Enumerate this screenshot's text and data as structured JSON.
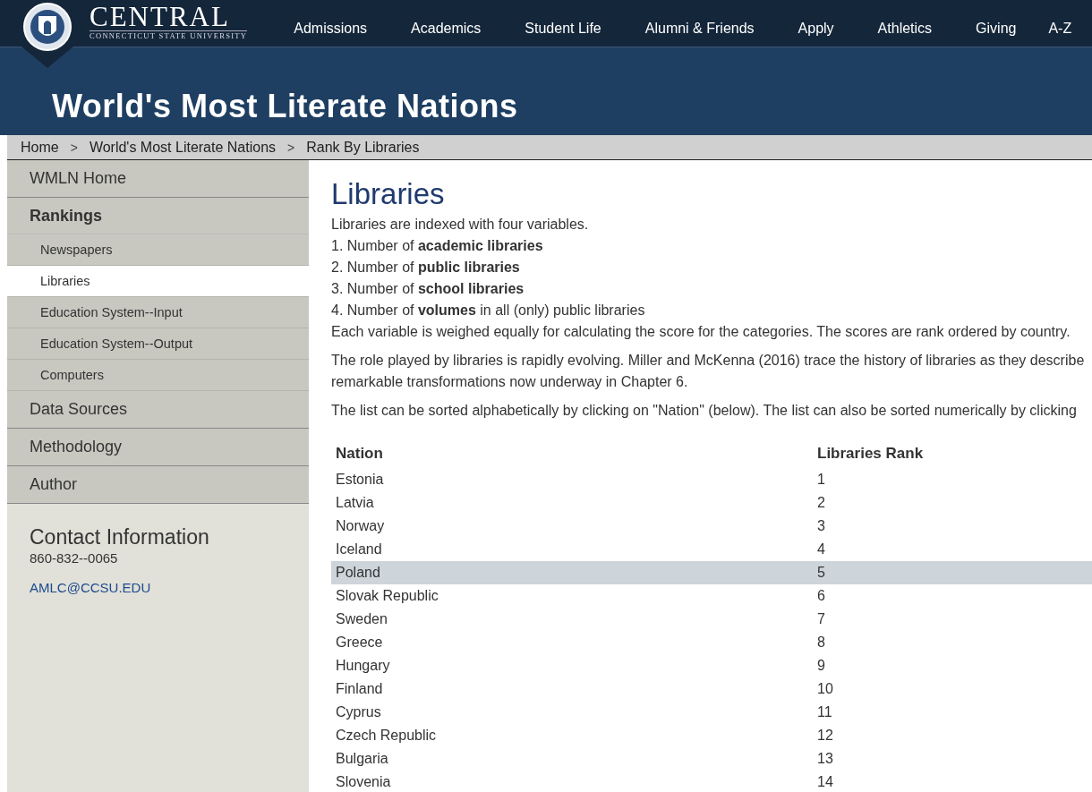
{
  "logo": {
    "name": "CENTRAL",
    "subtitle": "CONNECTICUT STATE UNIVERSITY"
  },
  "nav": [
    "Admissions",
    "Academics",
    "Student Life",
    "Alumni & Friends",
    "Apply",
    "Athletics",
    "Giving",
    "A-Z"
  ],
  "banner": {
    "title": "World's Most Literate Nations"
  },
  "breadcrumb": {
    "items": [
      "Home",
      "World's Most Literate Nations",
      "Rank By Libraries"
    ],
    "separator": ">"
  },
  "sidebar": {
    "items": [
      {
        "label": "WMLN Home",
        "selected": false
      },
      {
        "label": "Rankings",
        "selected": false,
        "children": [
          {
            "label": "Newspapers",
            "selected": false
          },
          {
            "label": "Libraries",
            "selected": true
          },
          {
            "label": "Education System--Input",
            "selected": false
          },
          {
            "label": "Education System--Output",
            "selected": false
          },
          {
            "label": "Computers",
            "selected": false
          }
        ]
      },
      {
        "label": "Data Sources",
        "selected": false
      },
      {
        "label": "Methodology",
        "selected": false
      },
      {
        "label": "Author",
        "selected": false
      }
    ],
    "contact": {
      "heading": "Contact Information",
      "phone": "860-832--0065",
      "email": "AMLC@CCSU.EDU"
    }
  },
  "main": {
    "heading": "Libraries",
    "intro": [
      "Libraries are indexed with four variables.",
      "1. Number of **academic libraries**",
      "2. Number of **public libraries**",
      "3. Number of **school libraries**",
      "4. Number of **volumes** in all (only) public libraries",
      "Each variable is weighed equally for calculating the score for the categories. The scores are rank ordered by country."
    ],
    "paragraphs": [
      [
        "The role played by libraries is rapidly evolving. Miller and McKenna (2016) trace the history of libraries as they describe",
        "remarkable transformations now underway in Chapter 6."
      ],
      [
        "The list can be sorted alphabetically by clicking on \"Nation\" (below). The list can also be sorted numerically by clicking"
      ]
    ],
    "table": {
      "columns": [
        "Nation",
        "Libraries Rank"
      ],
      "rows": [
        {
          "nation": "Estonia",
          "rank": "1",
          "selected": false
        },
        {
          "nation": "Latvia",
          "rank": "2",
          "selected": false
        },
        {
          "nation": "Norway",
          "rank": "3",
          "selected": false
        },
        {
          "nation": "Iceland",
          "rank": "4",
          "selected": false
        },
        {
          "nation": "Poland",
          "rank": "5",
          "selected": true
        },
        {
          "nation": "Slovak Republic",
          "rank": "6",
          "selected": false
        },
        {
          "nation": "Sweden",
          "rank": "7",
          "selected": false
        },
        {
          "nation": "Greece",
          "rank": "8",
          "selected": false
        },
        {
          "nation": "Hungary",
          "rank": "9",
          "selected": false
        },
        {
          "nation": "Finland",
          "rank": "10",
          "selected": false
        },
        {
          "nation": "Cyprus",
          "rank": "11",
          "selected": false
        },
        {
          "nation": "Czech Republic",
          "rank": "12",
          "selected": false
        },
        {
          "nation": "Bulgaria",
          "rank": "13",
          "selected": false
        },
        {
          "nation": "Slovenia",
          "rank": "14",
          "selected": false
        }
      ]
    }
  }
}
